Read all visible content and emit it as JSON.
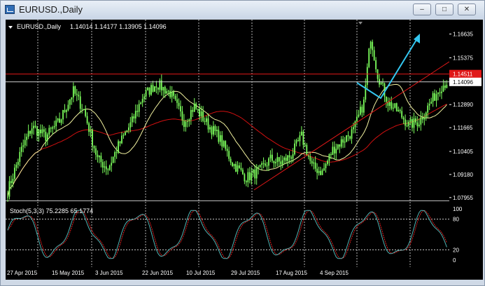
{
  "window": {
    "title": "EURUSD.,Daily",
    "minimize": "–",
    "maximize": "□",
    "close": "✕"
  },
  "chart_header": {
    "symbol": "EURUSD.,Daily",
    "ohlc": "1.14014 1.14177 1.13905 1.14096"
  },
  "stoch_header": "Stoch(5,3,3) 75.2285 65.1774",
  "colors": {
    "candle": "#7cff5c",
    "ma_fast": "#f2f2a0",
    "ma_slow": "#d01010",
    "trend": "#e01818",
    "arrow": "#34c7f0",
    "stoch_main": "#4fb3b3",
    "stoch_signal": "#e02020",
    "price_label": "#e01818"
  },
  "chart_data": {
    "type": "candlestick",
    "price_ticks": [
      "1.16635",
      "1.15375",
      "1.14511",
      "1.14096",
      "1.12890",
      "1.11665",
      "1.10405",
      "1.09180",
      "1.07955"
    ],
    "price_ylim": [
      1.078,
      1.174
    ],
    "current_price": "1.14096",
    "resistance_price": "1.14511",
    "x_labels": [
      "27 Apr 2015",
      "15 May 2015",
      "3 Jun 2015",
      "22 Jun 2015",
      "10 Jul 2015",
      "29 Jul 2015",
      "17 Aug 2015",
      "4 Sep 2015"
    ],
    "stoch_ticks": [
      "100",
      "80",
      "20",
      "0"
    ],
    "stoch_levels": [
      80,
      20
    ]
  }
}
